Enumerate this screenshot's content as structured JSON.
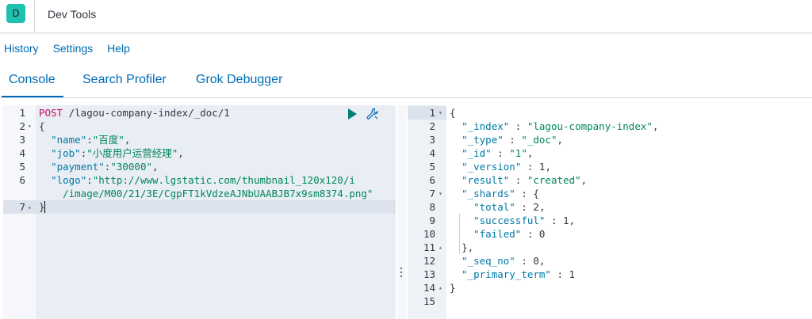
{
  "header": {
    "logo_letter": "D",
    "title": "Dev Tools"
  },
  "top_menu": {
    "history": "History",
    "settings": "Settings",
    "help": "Help"
  },
  "tabs": {
    "console": "Console",
    "search_profiler": "Search Profiler",
    "grok_debugger": "Grok Debugger"
  },
  "request_editor": {
    "line_numbers": [
      "1",
      "2",
      "3",
      "4",
      "5",
      "6",
      "",
      "7"
    ],
    "method": "POST",
    "url": " /lagou-company-index/_doc/1",
    "open_brace": "{",
    "name_key": "\"name\"",
    "name_val": "\"百度\"",
    "job_key": "\"job\"",
    "job_val": "\"小度用户运营经理\"",
    "payment_key": "\"payment\"",
    "payment_val": "\"30000\"",
    "logo_key": "\"logo\"",
    "logo_val_1": "\"http://www.lgstatic.com/thumbnail_120x120/i",
    "logo_val_2": "/image/M00/21/3E/CgpFT1kVdzeAJNbUAABJB7x9sm8374.png\"",
    "close_brace": "}"
  },
  "response_viewer": {
    "line_numbers": [
      "1",
      "2",
      "3",
      "4",
      "5",
      "6",
      "7",
      "8",
      "9",
      "10",
      "11",
      "12",
      "13",
      "14",
      "15"
    ],
    "open_brace": "{",
    "index_key": "\"_index\"",
    "index_val": "\"lagou-company-index\"",
    "type_key": "\"_type\"",
    "type_val": "\"_doc\"",
    "id_key": "\"_id\"",
    "id_val": "\"1\"",
    "version_key": "\"_version\"",
    "version_val": "1",
    "result_key": "\"result\"",
    "result_val": "\"created\"",
    "shards_key": "\"_shards\"",
    "total_key": "\"total\"",
    "total_val": "2",
    "successful_key": "\"successful\"",
    "successful_val": "1",
    "failed_key": "\"failed\"",
    "failed_val": "0",
    "shards_close": "},",
    "seq_no_key": "\"_seq_no\"",
    "seq_no_val": "0",
    "primary_term_key": "\"_primary_term\"",
    "primary_term_val": "1",
    "close_brace": "}"
  },
  "icons": {
    "run": "play-icon",
    "settings": "wrench-icon",
    "resize": "vertical-dots-icon"
  },
  "colors": {
    "accent": "#006bb4",
    "logo_bg": "#20c0b0",
    "method": "#c80a68",
    "key": "#0079a5",
    "string": "#00875a",
    "run_icon": "#017d73"
  }
}
